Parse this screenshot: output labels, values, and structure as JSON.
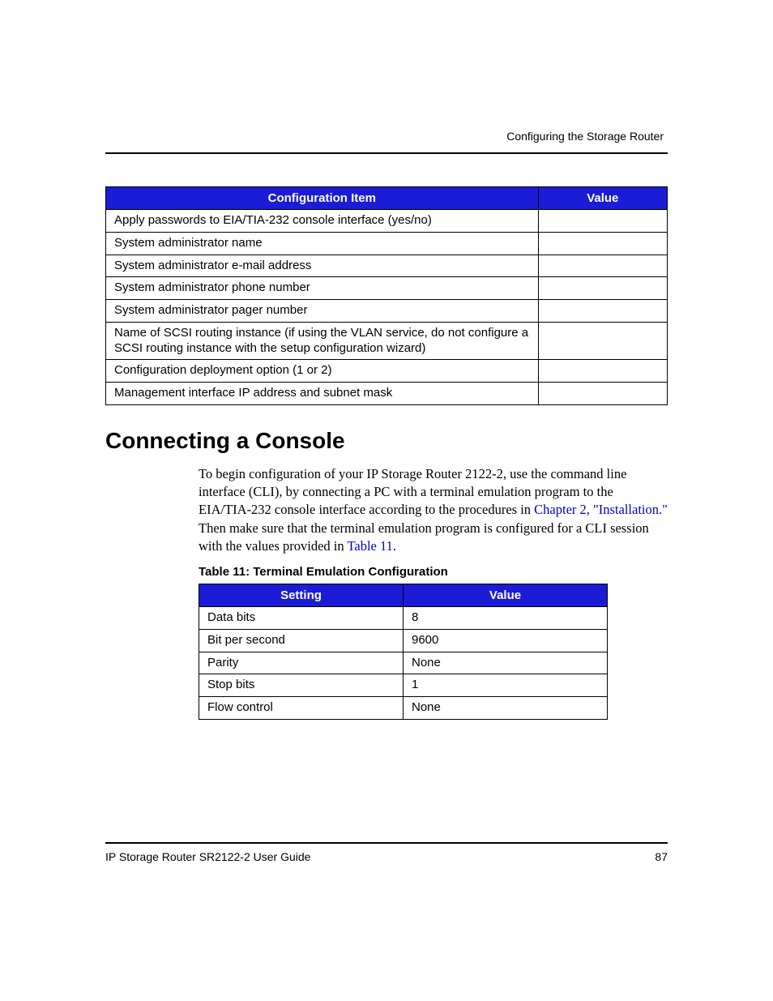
{
  "header": {
    "running_title": "Configuring the Storage Router"
  },
  "config_table": {
    "headers": {
      "item": "Configuration Item",
      "value": "Value"
    },
    "rows": [
      {
        "item": "Apply passwords to EIA/TIA-232 console interface (yes/no)",
        "value": ""
      },
      {
        "item": "System administrator name",
        "value": ""
      },
      {
        "item": "System administrator e-mail address",
        "value": ""
      },
      {
        "item": "System administrator phone number",
        "value": ""
      },
      {
        "item": "System administrator pager number",
        "value": ""
      },
      {
        "item": "Name of SCSI routing instance (if using the VLAN service, do not configure a SCSI routing instance with the setup configuration wizard)",
        "value": ""
      },
      {
        "item": "Configuration deployment option (1 or 2)",
        "value": ""
      },
      {
        "item": "Management interface IP address and subnet mask",
        "value": ""
      }
    ]
  },
  "section": {
    "heading": "Connecting a Console",
    "para_part1": "To begin configuration of your IP Storage Router 2122-2, use the command line interface (CLI), by connecting a PC with a terminal emulation program to the EIA/TIA-232 console interface according to the procedures in ",
    "link1": "Chapter 2, \"Installation.\"",
    "para_part2": " Then make sure that the terminal emulation program is configured for a CLI session with the values provided in ",
    "link2": "Table 11",
    "para_part3": "."
  },
  "terminal_table": {
    "caption": "Table 11:  Terminal Emulation Configuration",
    "headers": {
      "setting": "Setting",
      "value": "Value"
    },
    "rows": [
      {
        "setting": "Data bits",
        "value": "8"
      },
      {
        "setting": "Bit per second",
        "value": "9600"
      },
      {
        "setting": "Parity",
        "value": "None"
      },
      {
        "setting": "Stop bits",
        "value": "1"
      },
      {
        "setting": "Flow control",
        "value": "None"
      }
    ]
  },
  "footer": {
    "doc_title": "IP Storage Router SR2122-2 User Guide",
    "page_number": "87"
  }
}
